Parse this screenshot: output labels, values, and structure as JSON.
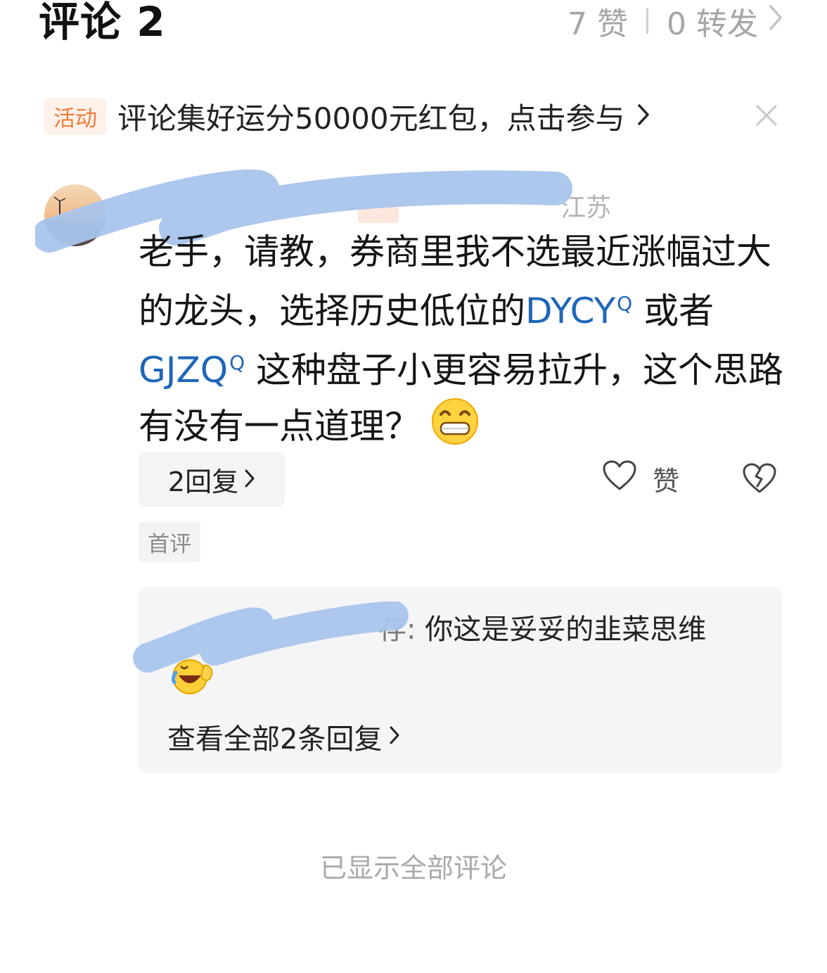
{
  "header": {
    "title": "评论 2",
    "likes": "7 赞",
    "forwards": "0 转发"
  },
  "activity": {
    "tag": "活动",
    "text": "评论集好运分50000元红包，点击参与"
  },
  "comment": {
    "location": "江苏",
    "body": {
      "part1": "老手，请教，券商里我不选最近涨幅过大的龙头，选择历史低位的",
      "kw1": "DYCY",
      "part2": " 或者",
      "kw2": "GJZQ",
      "part3": " 这种盘子小更容易拉升，这个思路有没有一点道理？"
    },
    "reply_count_label": "2回复",
    "like_label": "赞",
    "first_tag": "首评"
  },
  "replies": {
    "preview_user_tail": "存:",
    "preview_text": " 你这是妥妥的韭菜思维",
    "view_all": "查看全部2条回复"
  },
  "footer": {
    "note": "已显示全部评论"
  },
  "colors": {
    "keyword": "#1f66b8",
    "activity_tag": "#f27c3c",
    "redaction": "#a9c4ec"
  }
}
